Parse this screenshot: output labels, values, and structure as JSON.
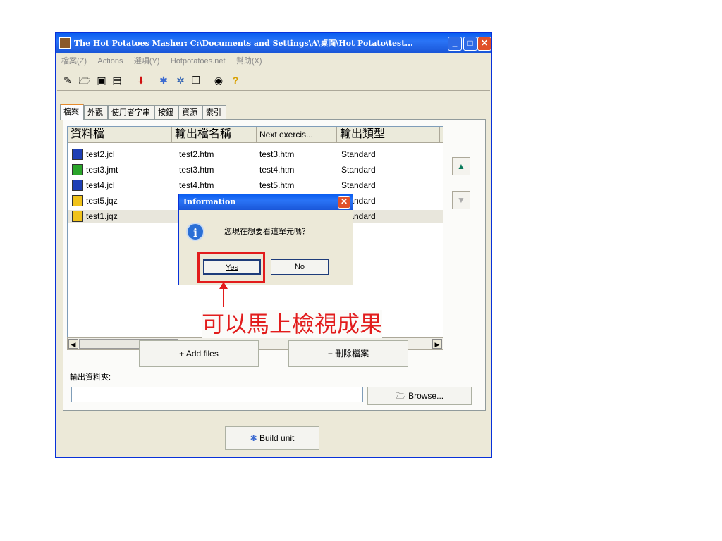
{
  "window": {
    "title": "The Hot Potatoes Masher: C:\\Documents and Settings\\A\\桌面\\Hot Potato\\test...",
    "minimize": "_",
    "maximize": "□",
    "close": "✕"
  },
  "menu": [
    "檔案(Z)",
    "Actions",
    "選項(Y)",
    "Hotpotatoes.net",
    "幫助(X)"
  ],
  "tabs": [
    "檔案",
    "外觀",
    "使用者字串",
    "按鈕",
    "資源",
    "索引"
  ],
  "list": {
    "columns": [
      "資料檔",
      "輸出檔名稱",
      "Next exercis...",
      "輸出類型"
    ],
    "rows": [
      {
        "file": "test2.jcl",
        "output": "test2.htm",
        "next": "test3.htm",
        "type": "Standard",
        "icon_color": "#1e3fb5"
      },
      {
        "file": "test3.jmt",
        "output": "test3.htm",
        "next": "test4.htm",
        "type": "Standard",
        "icon_color": "#2aa52a"
      },
      {
        "file": "test4.jcl",
        "output": "test4.htm",
        "next": "test5.htm",
        "type": "Standard",
        "icon_color": "#1e3fb5"
      },
      {
        "file": "test5.jqz",
        "output": "",
        "next": "",
        "type": "Standard",
        "icon_color": "#f0c21a"
      },
      {
        "file": "test1.jqz",
        "output": "",
        "next": "",
        "type": "Standard",
        "icon_color": "#f0c21a"
      }
    ]
  },
  "buttons": {
    "add_files": "+ Add files",
    "delete_files": "− 刪除檔案",
    "browse": "Browse...",
    "build_unit": "Build unit",
    "up": "▲",
    "down": "▼"
  },
  "output_folder": {
    "label": "輸出資料夾:",
    "value": ""
  },
  "dialog": {
    "title": "Information",
    "close": "✕",
    "icon": "i",
    "message": "您現在想要看這單元嗎？",
    "yes": "Yes",
    "no": "No"
  },
  "annotation": {
    "text": "可以馬上檢視成果",
    "color": "#e21c1c"
  }
}
